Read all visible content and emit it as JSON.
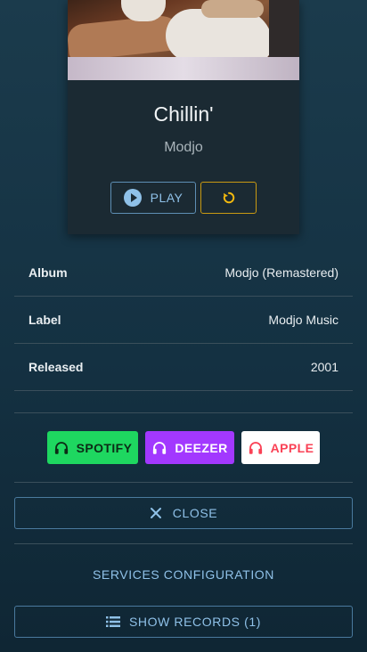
{
  "track": {
    "title": "Chillin'",
    "artist": "Modjo"
  },
  "player": {
    "play_label": "PLAY",
    "play_icon": "play-circle-icon",
    "refresh_icon": "refresh-icon"
  },
  "details": [
    {
      "label": "Album",
      "value": "Modjo (Remastered)"
    },
    {
      "label": "Label",
      "value": "Modjo Music"
    },
    {
      "label": "Released",
      "value": "2001"
    }
  ],
  "services": {
    "spotify": "SPOTIFY",
    "deezer": "DEEZER",
    "apple": "APPLE",
    "icon": "headphones-icon"
  },
  "actions": {
    "close_label": "CLOSE",
    "config_label": "SERVICES CONFIGURATION",
    "records_label": "SHOW RECORDS (1)"
  },
  "colors": {
    "accent": "#8fc1e8",
    "refresh_border": "#c99a12",
    "spotify": "#1ed760",
    "deezer": "#a238ff",
    "apple_text": "#fa4155"
  }
}
